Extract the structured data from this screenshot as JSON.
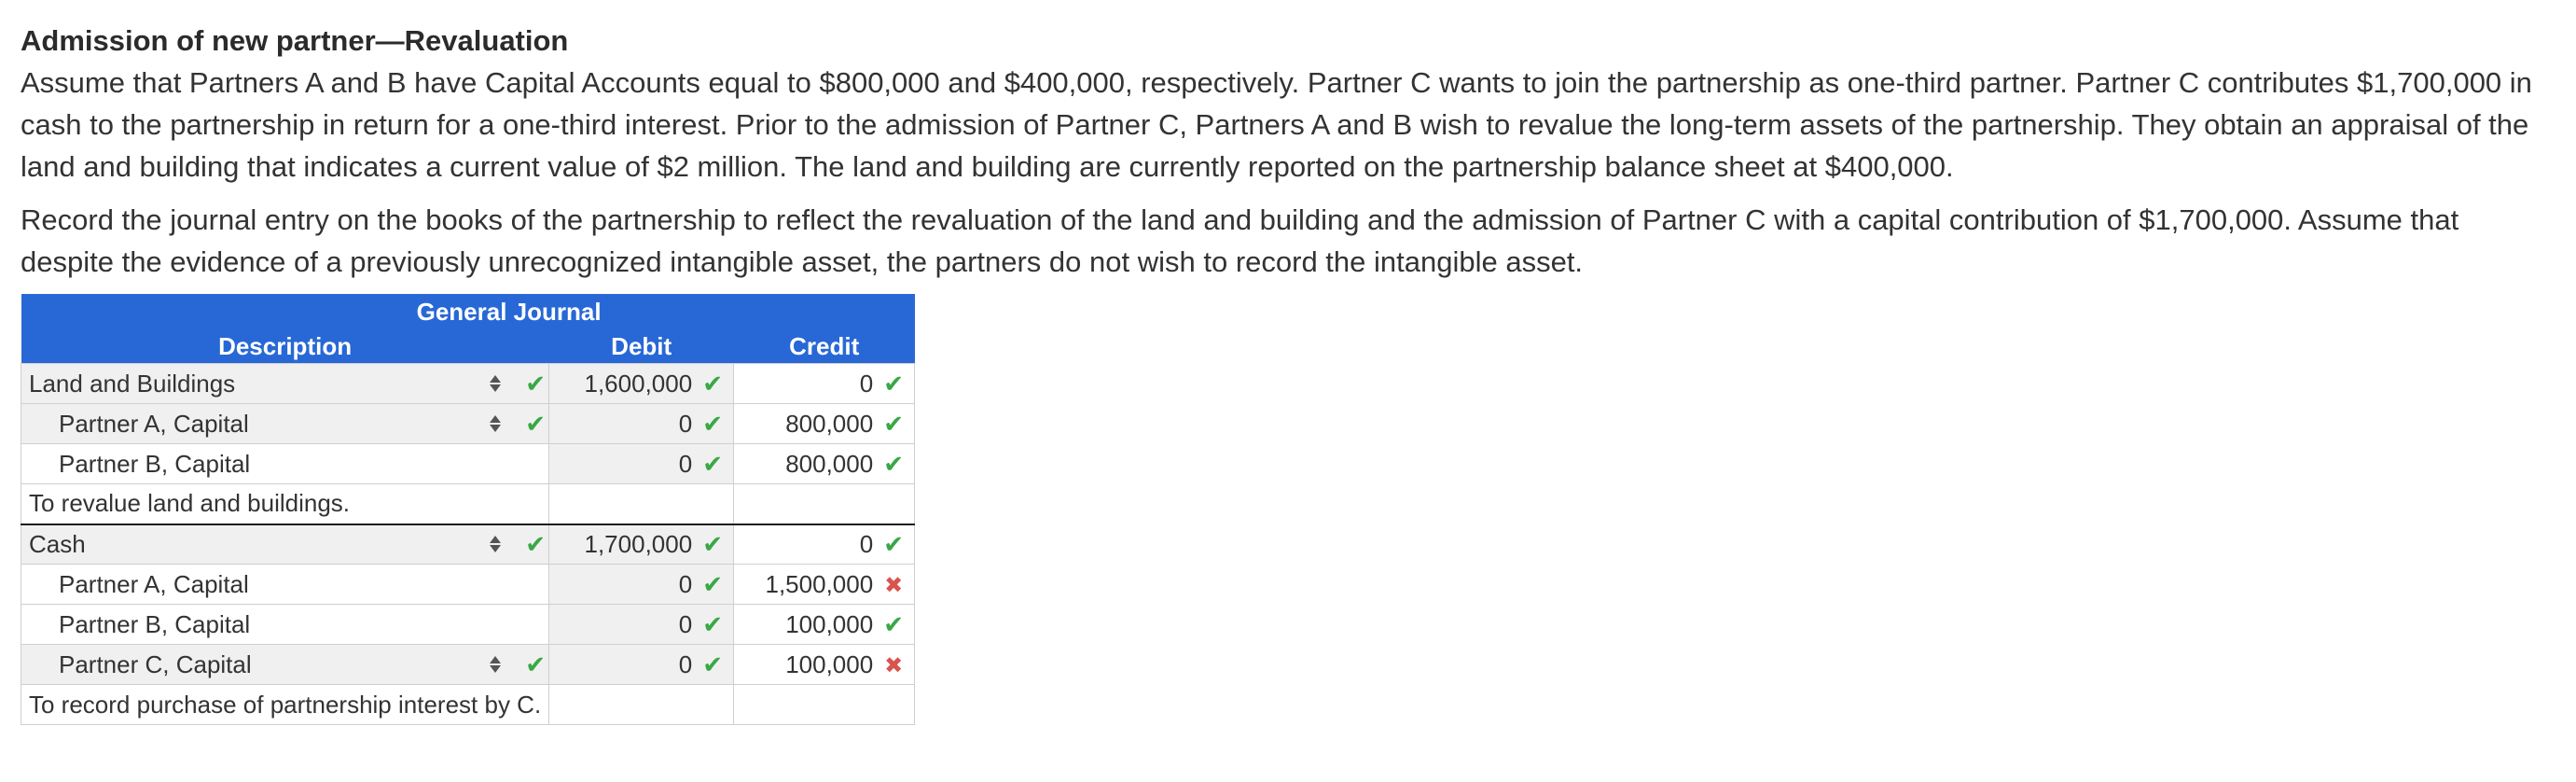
{
  "problem": {
    "title": "Admission of new partner—Revaluation",
    "paragraph1": "Assume that Partners A and B have Capital Accounts equal to $800,000 and $400,000, respectively. Partner C wants to join the partnership as one-third partner. Partner C contributes $1,700,000 in cash to the partnership in return for a one-third interest. Prior to the admission of Partner C, Partners A and B wish to revalue the long-term assets of the partnership. They obtain an appraisal of the land and building that indicates a current value of $2 million. The land and building are currently reported on the partnership balance sheet at $400,000.",
    "paragraph2": "Record the journal entry on the books of the partnership to reflect the revaluation of the land and building and the admission of Partner C with a capital contribution of $1,700,000. Assume that despite the evidence of a previously unrecognized intangible asset, the partners do not wish to record the intangible asset."
  },
  "journal": {
    "title": "General Journal",
    "headers": {
      "description": "Description",
      "debit": "Debit",
      "credit": "Credit"
    },
    "rows": [
      {
        "description": "Land and Buildings",
        "debit": "1,600,000",
        "credit": "0"
      },
      {
        "description": "Partner A, Capital",
        "debit": "0",
        "credit": "800,000"
      },
      {
        "description": "Partner B, Capital",
        "debit": "0",
        "credit": "800,000"
      },
      {
        "description": "To revalue land and buildings."
      },
      {
        "description": "Cash",
        "debit": "1,700,000",
        "credit": "0"
      },
      {
        "description": "Partner A, Capital",
        "debit": "0",
        "credit": "1,500,000"
      },
      {
        "description": "Partner B, Capital",
        "debit": "0",
        "credit": "100,000"
      },
      {
        "description": "Partner C, Capital",
        "debit": "0",
        "credit": "100,000"
      },
      {
        "description": "To record purchase of partnership interest by C."
      }
    ]
  },
  "icons": {
    "correct": "check-icon",
    "incorrect": "x-icon",
    "select": "up-down-arrows-icon"
  },
  "colors": {
    "header_bg": "#2868d6",
    "correct": "#39a845",
    "incorrect": "#d9534f",
    "shaded_cell": "#f0f0f0"
  }
}
